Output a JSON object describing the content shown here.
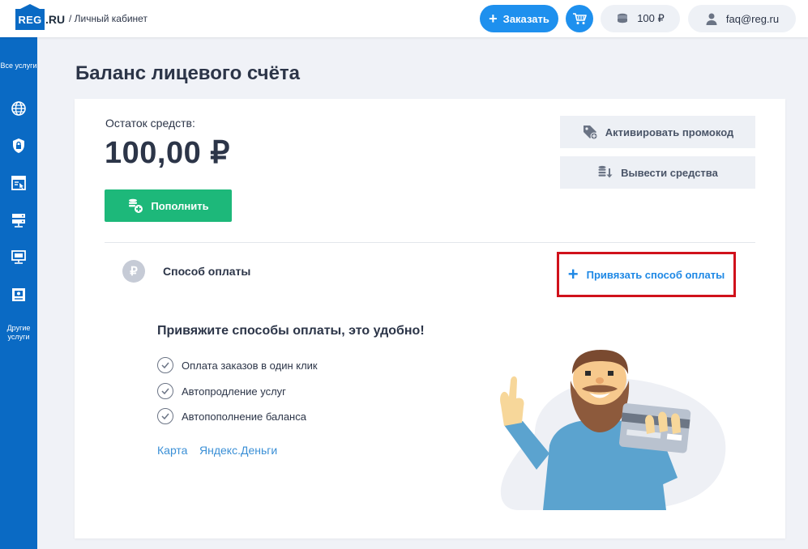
{
  "header": {
    "logo_suffix": ".RU",
    "logo_box": "REG",
    "breadcrumb": "/ Личный кабинет",
    "order_label": "Заказать",
    "balance_label": "100 ₽",
    "user_email": "faq@reg.ru"
  },
  "sidebar": {
    "all_services": "Все услуги",
    "other_services": "Другие услуги",
    "icons": [
      "globe-icon",
      "shield-lock-icon",
      "website-builder-icon",
      "server-icon",
      "remote-desktop-icon",
      "dashboard-icon"
    ]
  },
  "main": {
    "page_title": "Баланс лицевого счёта",
    "balance_label": "Остаток средств:",
    "balance_value": "100,00 ₽",
    "topup_label": "Пополнить",
    "promo_label": "Активировать промокод",
    "withdraw_label": "Вывести средства",
    "payment_method": {
      "title": "Способ оплаты",
      "add_label": "Привязать способ оплаты",
      "heading": "Привяжите способы оплаты, это удобно!",
      "features": [
        "Оплата заказов в один клик",
        "Автопродление услуг",
        "Автопополнение баланса"
      ],
      "links": [
        "Карта",
        "Яндекс.Деньги"
      ]
    }
  },
  "colors": {
    "brand_blue": "#0a6ac4",
    "accent_blue": "#1e90ee",
    "green": "#1db87a",
    "highlight_red": "#d0111b"
  }
}
